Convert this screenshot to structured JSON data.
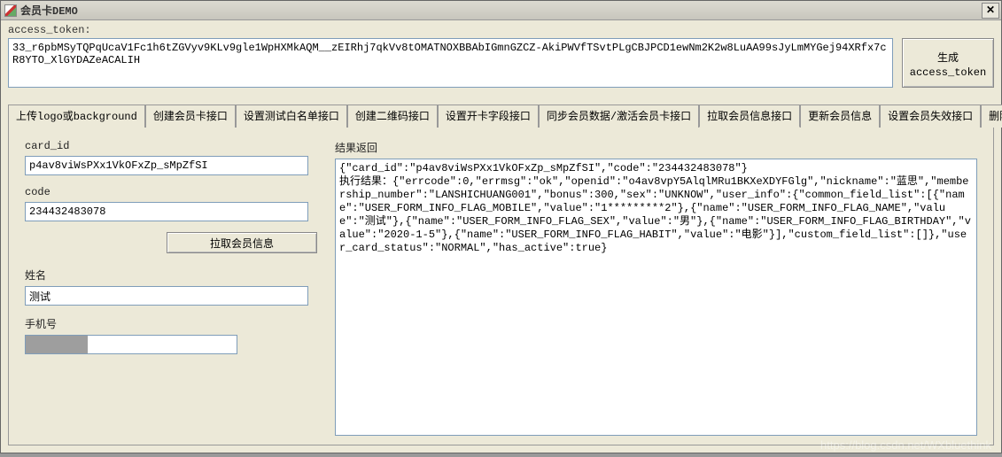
{
  "title": "会员卡DEMO",
  "token_section": {
    "label": "access_token:",
    "value": "33_r6pbMSyTQPqUcaV1Fc1h6tZGVyv9KLv9gle1WpHXMkAQM__zEIRhj7qkVv8tOMATNOXBBAbIGmnGZCZ-AkiPWVfTSvtPLgCBJPCD1ewNm2K2w8LuAA99sJyLmMYGej94XRfx7cR8YTO_XlGYDAZeACALIH",
    "gen_button_line1": "生成",
    "gen_button_line2": "access_token"
  },
  "tabs": [
    {
      "label": "上传logo或background"
    },
    {
      "label": "创建会员卡接口"
    },
    {
      "label": "设置测试白名单接口"
    },
    {
      "label": "创建二维码接口"
    },
    {
      "label": "设置开卡字段接口"
    },
    {
      "label": "同步会员数据/激活会员卡接口"
    },
    {
      "label": "拉取会员信息接口"
    },
    {
      "label": "更新会员信息"
    },
    {
      "label": "设置会员失效接口"
    },
    {
      "label": "删除会员卡"
    }
  ],
  "active_tab": 6,
  "form": {
    "card_id_label": "card_id",
    "card_id_value": "p4av8viWsPXx1VkOFxZp_sMpZfSI",
    "code_label": "code",
    "code_value": "234432483078",
    "fetch_button": "拉取会员信息",
    "name_label": "姓名",
    "name_value": "测试",
    "phone_label": "手机号",
    "phone_value": ""
  },
  "result": {
    "label": "结果返回",
    "text": "{\"card_id\":\"p4av8viWsPXx1VkOFxZp_sMpZfSI\",\"code\":\"234432483078\"}\n执行结果：{\"errcode\":0,\"errmsg\":\"ok\",\"openid\":\"o4av8vpY5AlqlMRu1BKXeXDYFGlg\",\"nickname\":\"蓝思\",\"membership_number\":\"LANSHICHUANG001\",\"bonus\":300,\"sex\":\"UNKNOW\",\"user_info\":{\"common_field_list\":[{\"name\":\"USER_FORM_INFO_FLAG_MOBILE\",\"value\":\"1*********2\"},{\"name\":\"USER_FORM_INFO_FLAG_NAME\",\"value\":\"测试\"},{\"name\":\"USER_FORM_INFO_FLAG_SEX\",\"value\":\"男\"},{\"name\":\"USER_FORM_INFO_FLAG_BIRTHDAY\",\"value\":\"2020-1-5\"},{\"name\":\"USER_FORM_INFO_FLAG_HABIT\",\"value\":\"电影\"}],\"custom_field_list\":[]},\"user_card_status\":\"NORMAL\",\"has_active\":true}"
  },
  "watermark": "https://blog.csdn.net/WXbluethink"
}
